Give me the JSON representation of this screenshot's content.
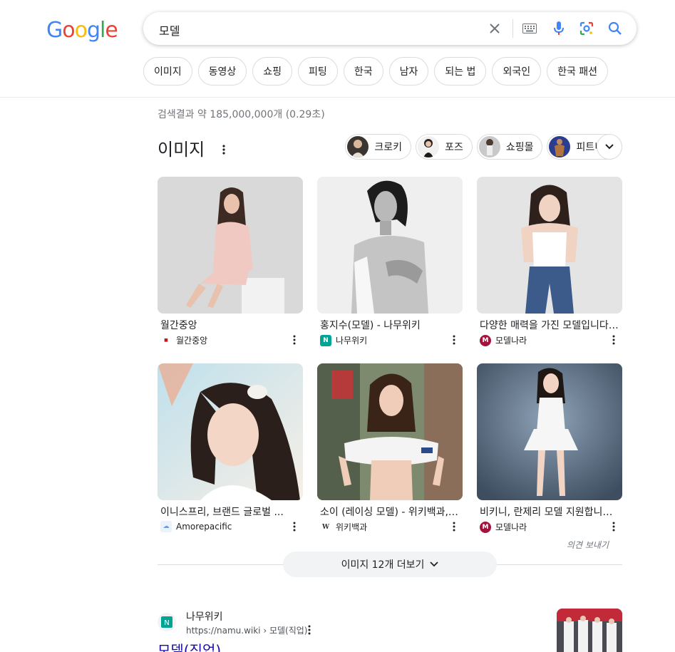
{
  "logo": {
    "letters": [
      "G",
      "o",
      "o",
      "g",
      "l",
      "e"
    ],
    "colors": [
      "#4285F4",
      "#EA4335",
      "#FBBC05",
      "#4285F4",
      "#34A853",
      "#EA4335"
    ]
  },
  "search": {
    "query": "모델",
    "icons": [
      "close-icon",
      "keyboard-icon",
      "microphone-icon",
      "lens-icon",
      "search-icon"
    ]
  },
  "chips": [
    "이미지",
    "동영상",
    "쇼핑",
    "피팅",
    "한국",
    "남자",
    "되는 법",
    "외국인",
    "한국 패션"
  ],
  "result_stats": "검색결과 약 185,000,000개 (0.29초)",
  "images": {
    "title": "이미지",
    "filters": [
      {
        "label": "크로키"
      },
      {
        "label": "포즈"
      },
      {
        "label": "쇼핑몰"
      },
      {
        "label": "피트니스"
      }
    ],
    "cards": [
      {
        "caption": "월간중앙",
        "source": "월간중앙",
        "favicon": "월간중앙",
        "fav_bg": "#ffffff",
        "fav_fg": "#c4161c"
      },
      {
        "caption": "홍지수(모델) - 나무위키",
        "source": "나무위키",
        "favicon": "N",
        "fav_bg": "#00a495",
        "fav_fg": "#ffffff"
      },
      {
        "caption": "다양한 매력을 가진 모델입니다 ...",
        "source": "모델나라",
        "favicon": "M",
        "fav_bg": "#a4133c",
        "fav_fg": "#ffffff"
      },
      {
        "caption": "이니스프리, 브랜드 글로벌 ...",
        "source": "Amorepacific",
        "favicon": "☁",
        "fav_bg": "#eaf2fb",
        "fav_fg": "#6f9fd8"
      },
      {
        "caption": "소이 (레이싱 모델) - 위키백과, ...",
        "source": "위키백과",
        "favicon": "W",
        "fav_bg": "#ffffff",
        "fav_fg": "#333333"
      },
      {
        "caption": "비키니, 란제리 모델 지원합니다 ...",
        "source": "모델나라",
        "favicon": "M",
        "fav_bg": "#a4133c",
        "fav_fg": "#ffffff"
      }
    ],
    "feedback": "의견 보내기",
    "more_label": "이미지 12개 더보기"
  },
  "web_result": {
    "site": "나무위키",
    "url": "https://namu.wiki › 모델(직업)",
    "title": "모델(직업)"
  }
}
